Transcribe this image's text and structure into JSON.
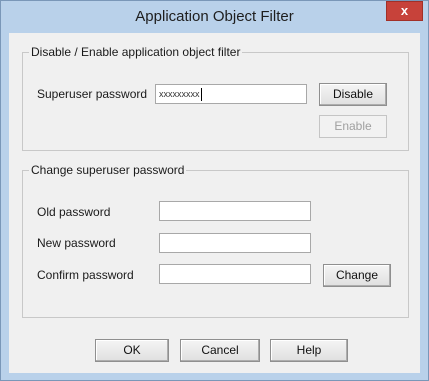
{
  "window": {
    "title": "Application Object Filter",
    "close_glyph": "x"
  },
  "disable_group": {
    "legend": "Disable / Enable application object filter",
    "password_label": "Superuser password",
    "password_value": "xxxxxxxxx",
    "disable_label": "Disable",
    "enable_label": "Enable"
  },
  "change_group": {
    "legend": "Change superuser password",
    "old_label": "Old password",
    "new_label": "New password",
    "confirm_label": "Confirm password",
    "old_value": "",
    "new_value": "",
    "confirm_value": "",
    "change_label": "Change"
  },
  "footer": {
    "ok_label": "OK",
    "cancel_label": "Cancel",
    "help_label": "Help"
  },
  "colors": {
    "frame": "#b9d1ea",
    "close": "#c7423a",
    "client": "#f0f0f0"
  }
}
